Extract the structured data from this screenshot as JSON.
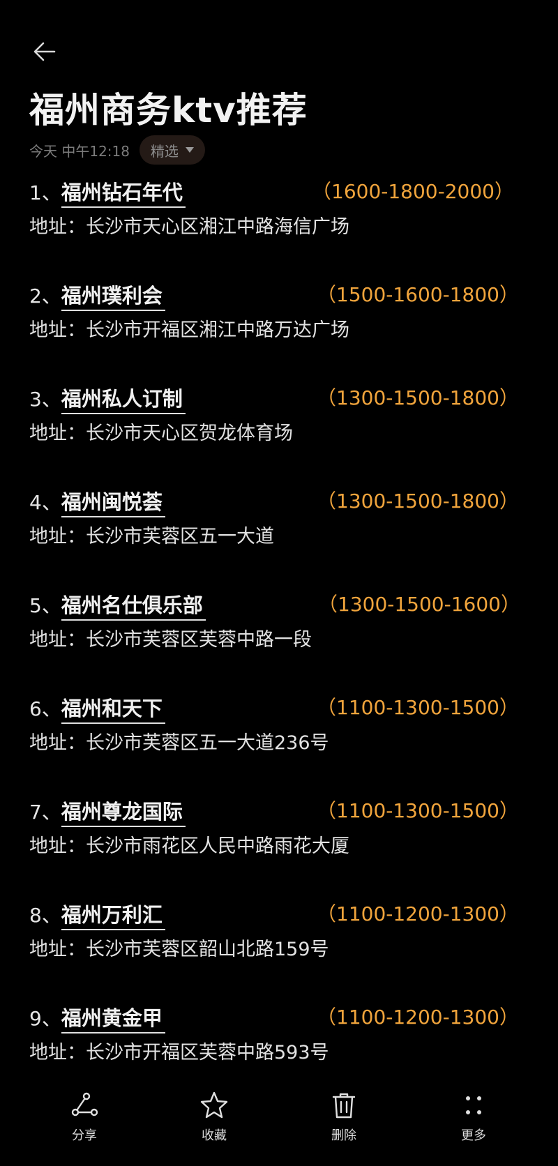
{
  "header": {
    "back_icon": "arrow-left-icon",
    "title": "福州商务ktv推荐",
    "timestamp": "今天 中午12:18",
    "tag_label": "精选",
    "tag_icon": "caret-down-icon"
  },
  "colors": {
    "background": "#000000",
    "price": "#f0a43c",
    "text": "#e8e8e8",
    "meta": "#7c7c7c"
  },
  "items": [
    {
      "index": "1、",
      "name": "福州钻石年代",
      "price": "（1600-1800-2000）",
      "address": "地址：长沙市天心区湘江中路海信广场"
    },
    {
      "index": "2、",
      "name": "福州璞利会",
      "price": "（1500-1600-1800）",
      "address": "地址：长沙市开福区湘江中路万达广场"
    },
    {
      "index": "3、",
      "name": "福州私人订制",
      "price": "（1300-1500-1800）",
      "address": "地址：长沙市天心区贺龙体育场"
    },
    {
      "index": "4、",
      "name": "福州闽悦荟",
      "price": "（1300-1500-1800）",
      "address": "地址：长沙市芙蓉区五一大道"
    },
    {
      "index": "5、",
      "name": "福州名仕俱乐部",
      "price": "（1300-1500-1600）",
      "address": "地址：长沙市芙蓉区芙蓉中路一段"
    },
    {
      "index": "6、",
      "name": "福州和天下",
      "price": "（1100-1300-1500）",
      "address": "地址：长沙市芙蓉区五一大道236号"
    },
    {
      "index": "7、",
      "name": "福州尊龙国际",
      "price": "（1100-1300-1500）",
      "address": "地址：长沙市雨花区人民中路雨花大厦"
    },
    {
      "index": "8、",
      "name": "福州万利汇",
      "price": "（1100-1200-1300）",
      "address": "地址：长沙市芙蓉区韶山北路159号"
    },
    {
      "index": "9、",
      "name": "福州黄金甲",
      "price": "（1100-1200-1300）",
      "address": "地址：长沙市开福区芙蓉中路593号"
    }
  ],
  "bottom_bar": {
    "share": {
      "label": "分享",
      "icon": "share-icon"
    },
    "favorite": {
      "label": "收藏",
      "icon": "star-icon"
    },
    "delete": {
      "label": "删除",
      "icon": "trash-icon"
    },
    "more": {
      "label": "更多",
      "icon": "more-dots-icon"
    }
  }
}
